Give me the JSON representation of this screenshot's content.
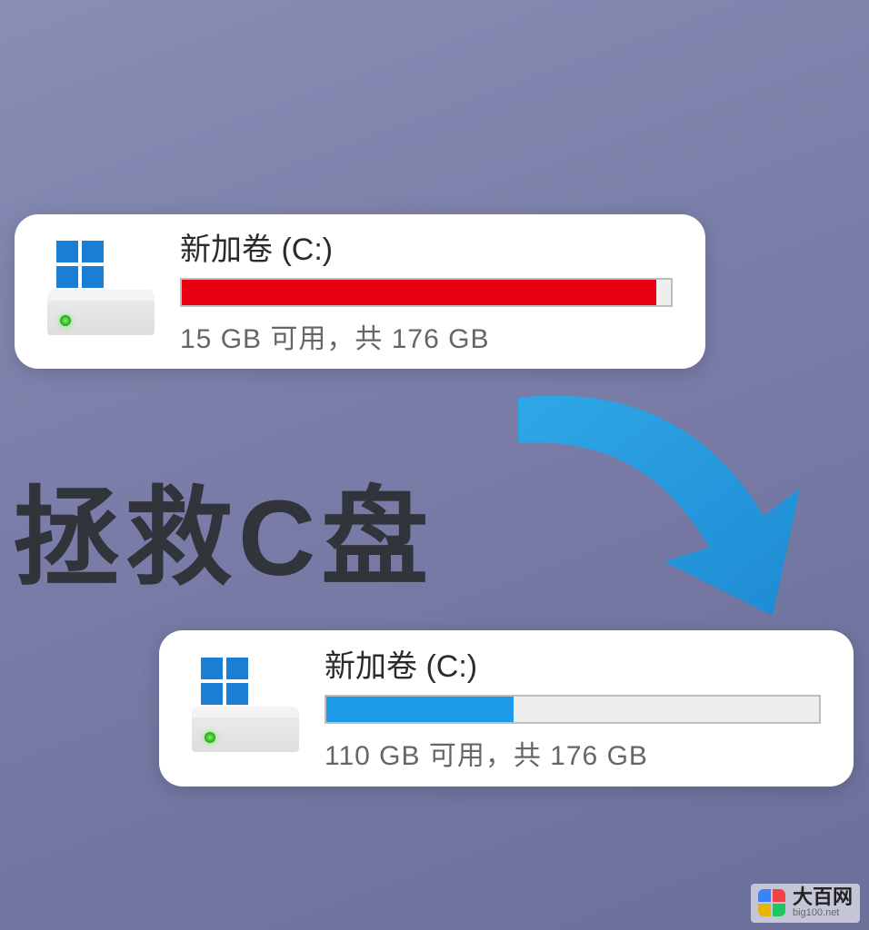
{
  "headline": "拯救C盘",
  "drive_before": {
    "label": "新加卷 (C:)",
    "status": "15 GB 可用，共 176 GB",
    "fill_percent": 97,
    "fill_color": "#e60012"
  },
  "drive_after": {
    "label": "新加卷 (C:)",
    "status": "110 GB 可用，共 176 GB",
    "fill_percent": 38,
    "fill_color": "#1e9be8"
  },
  "watermark": {
    "title": "大百网",
    "url": "big100.net"
  }
}
